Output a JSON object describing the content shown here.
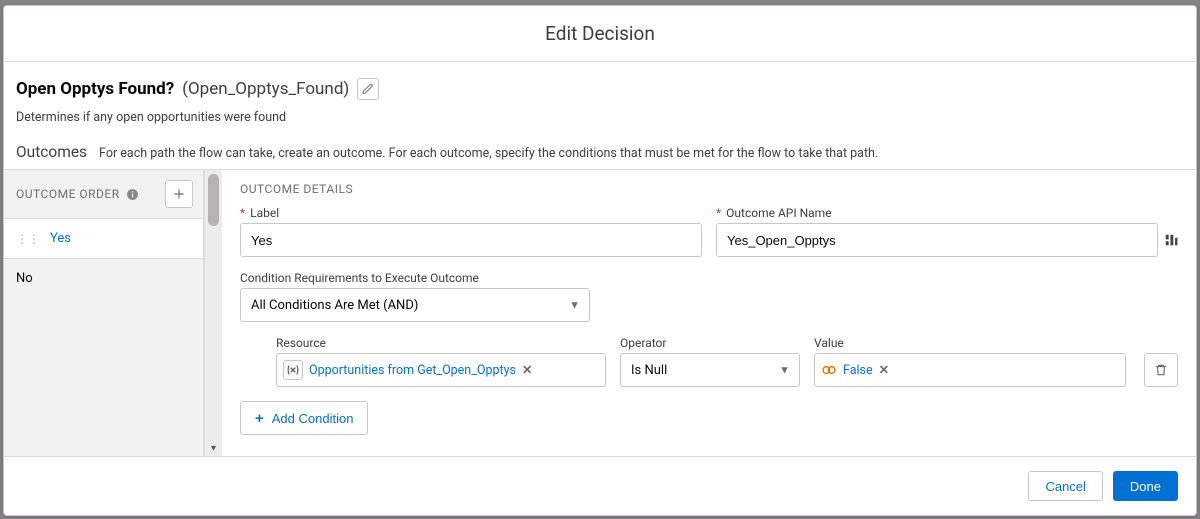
{
  "modal": {
    "title": "Edit Decision"
  },
  "decision": {
    "label": "Open Opptys Found?",
    "apiDisplay": "(Open_Opptys_Found)",
    "description": "Determines if any open opportunities were found"
  },
  "outcomes": {
    "heading": "Outcomes",
    "help": "For each path the flow can take, create an outcome. For each outcome, specify the conditions that must be met for the flow to take that path."
  },
  "sidebar": {
    "header": "OUTCOME ORDER",
    "items": [
      {
        "label": "Yes",
        "active": true
      },
      {
        "label": "No",
        "active": false
      }
    ]
  },
  "details": {
    "header": "OUTCOME DETAILS",
    "fields": {
      "label": {
        "label": "Label",
        "value": "Yes"
      },
      "apiName": {
        "label": "Outcome API Name",
        "value": "Yes_Open_Opptys"
      }
    },
    "conditionSetting": {
      "label": "Condition Requirements to Execute Outcome",
      "selected": "All Conditions Are Met (AND)"
    },
    "conditions": {
      "columns": {
        "resource": "Resource",
        "operator": "Operator",
        "value": "Value"
      },
      "rows": [
        {
          "resource": "Opportunities from Get_Open_Opptys",
          "operator": "Is Null",
          "value": "False"
        }
      ],
      "addLabel": "Add Condition"
    }
  },
  "footer": {
    "cancel": "Cancel",
    "done": "Done"
  }
}
